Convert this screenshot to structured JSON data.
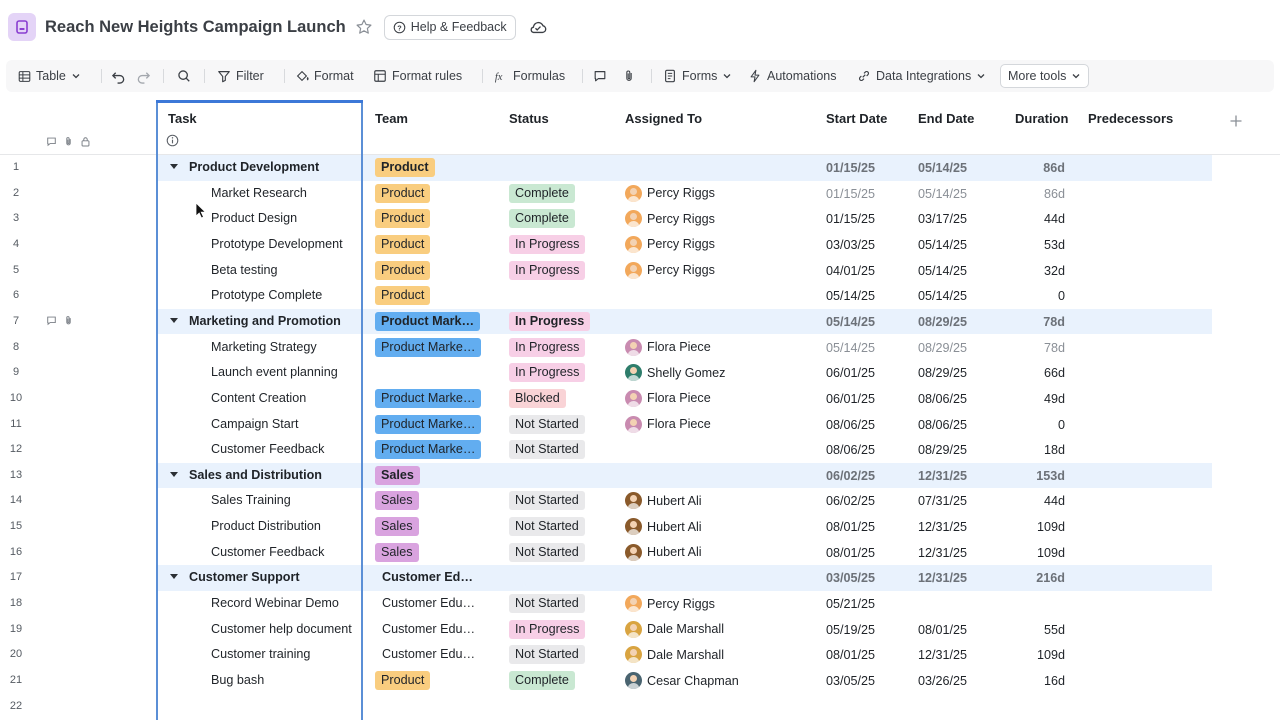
{
  "app": {
    "title": "Reach New Heights Campaign Launch",
    "help_label": "Help & Feedback"
  },
  "toolbar": {
    "view_label": "Table",
    "filter_label": "Filter",
    "format_label": "Format",
    "format_rules_label": "Format rules",
    "formulas_label": "Formulas",
    "forms_label": "Forms",
    "automations_label": "Automations",
    "data_integrations_label": "Data Integrations",
    "more_tools_label": "More tools"
  },
  "columns": {
    "task": "Task",
    "team": "Team",
    "status": "Status",
    "assigned": "Assigned To",
    "start": "Start Date",
    "end": "End Date",
    "duration": "Duration",
    "predecessors": "Predecessors"
  },
  "colors": {
    "product": "#f9cd7f",
    "marketing": "#62adf0",
    "sales": "#d9a3df",
    "complete": "#c9e8d2",
    "in_progress": "#f7cfe6",
    "blocked": "#f9d3d6",
    "not_started": "#e9e9eb",
    "selection_frame": "#3c78d8",
    "group_band": "#e9f2fd"
  },
  "rows": [
    {
      "num": "1",
      "type": "group",
      "task": "Product Development",
      "team": "Product",
      "team_color": "product",
      "status": "",
      "status_color": "",
      "assigned": "",
      "avatar": "",
      "start": "01/15/25",
      "end": "05/14/25",
      "duration": "86d"
    },
    {
      "num": "2",
      "type": "child",
      "task": "Market Research",
      "team": "Product",
      "team_color": "product",
      "status": "Complete",
      "status_color": "complete",
      "assigned": "Percy Riggs",
      "avatar": "#f2a85b",
      "start": "01/15/25",
      "end": "05/14/25",
      "duration": "86d",
      "muted": true
    },
    {
      "num": "3",
      "type": "child",
      "task": "Product Design",
      "team": "Product",
      "team_color": "product",
      "status": "Complete",
      "status_color": "complete",
      "assigned": "Percy Riggs",
      "avatar": "#f2a85b",
      "start": "01/15/25",
      "end": "03/17/25",
      "duration": "44d"
    },
    {
      "num": "4",
      "type": "child",
      "task": "Prototype Development",
      "team": "Product",
      "team_color": "product",
      "status": "In Progress",
      "status_color": "in_progress",
      "assigned": "Percy Riggs",
      "avatar": "#f2a85b",
      "start": "03/03/25",
      "end": "05/14/25",
      "duration": "53d"
    },
    {
      "num": "5",
      "type": "child",
      "task": "Beta testing",
      "team": "Product",
      "team_color": "product",
      "status": "In Progress",
      "status_color": "in_progress",
      "assigned": "Percy Riggs",
      "avatar": "#f2a85b",
      "start": "04/01/25",
      "end": "05/14/25",
      "duration": "32d"
    },
    {
      "num": "6",
      "type": "child",
      "task": "Prototype Complete",
      "team": "Product",
      "team_color": "product",
      "status": "",
      "status_color": "",
      "assigned": "",
      "avatar": "",
      "start": "05/14/25",
      "end": "05/14/25",
      "duration": "0"
    },
    {
      "num": "7",
      "type": "group",
      "task": "Marketing and Promotion",
      "team": "Product Mark…",
      "team_color": "marketing",
      "status": "In Progress",
      "status_color": "in_progress",
      "assigned": "",
      "avatar": "",
      "start": "05/14/25",
      "end": "08/29/25",
      "duration": "78d",
      "icons": true
    },
    {
      "num": "8",
      "type": "child",
      "task": "Marketing Strategy",
      "team": "Product Marke…",
      "team_color": "marketing",
      "status": "In Progress",
      "status_color": "in_progress",
      "assigned": "Flora Piece",
      "avatar": "#c98bb0",
      "start": "05/14/25",
      "end": "08/29/25",
      "duration": "78d",
      "muted": true
    },
    {
      "num": "9",
      "type": "child",
      "task": "Launch event planning",
      "team": "",
      "team_color": "",
      "status": "In Progress",
      "status_color": "in_progress",
      "assigned": "Shelly Gomez",
      "avatar": "#2e7d6b",
      "start": "06/01/25",
      "end": "08/29/25",
      "duration": "66d"
    },
    {
      "num": "10",
      "type": "child",
      "task": "Content Creation",
      "team": "Product Marke…",
      "team_color": "marketing",
      "status": "Blocked",
      "status_color": "blocked",
      "assigned": "Flora Piece",
      "avatar": "#c98bb0",
      "start": "06/01/25",
      "end": "08/06/25",
      "duration": "49d"
    },
    {
      "num": "11",
      "type": "child",
      "task": "Campaign Start",
      "team": "Product Marke…",
      "team_color": "marketing",
      "status": "Not Started",
      "status_color": "not_started",
      "assigned": "Flora Piece",
      "avatar": "#c98bb0",
      "start": "08/06/25",
      "end": "08/06/25",
      "duration": "0"
    },
    {
      "num": "12",
      "type": "child",
      "task": "Customer Feedback",
      "team": "Product Marke…",
      "team_color": "marketing",
      "status": "Not Started",
      "status_color": "not_started",
      "assigned": "",
      "avatar": "",
      "start": "08/06/25",
      "end": "08/29/25",
      "duration": "18d"
    },
    {
      "num": "13",
      "type": "group",
      "task": "Sales and Distribution",
      "team": "Sales",
      "team_color": "sales",
      "status": "",
      "status_color": "",
      "assigned": "",
      "avatar": "",
      "start": "06/02/25",
      "end": "12/31/25",
      "duration": "153d"
    },
    {
      "num": "14",
      "type": "child",
      "task": "Sales Training",
      "team": "Sales",
      "team_color": "sales",
      "status": "Not Started",
      "status_color": "not_started",
      "assigned": "Hubert Ali",
      "avatar": "#8a5a2b",
      "start": "06/02/25",
      "end": "07/31/25",
      "duration": "44d"
    },
    {
      "num": "15",
      "type": "child",
      "task": "Product Distribution",
      "team": "Sales",
      "team_color": "sales",
      "status": "Not Started",
      "status_color": "not_started",
      "assigned": "Hubert Ali",
      "avatar": "#8a5a2b",
      "start": "08/01/25",
      "end": "12/31/25",
      "duration": "109d"
    },
    {
      "num": "16",
      "type": "child",
      "task": "Customer Feedback",
      "team": "Sales",
      "team_color": "sales",
      "status": "Not Started",
      "status_color": "not_started",
      "assigned": "Hubert Ali",
      "avatar": "#8a5a2b",
      "start": "08/01/25",
      "end": "12/31/25",
      "duration": "109d"
    },
    {
      "num": "17",
      "type": "group",
      "task": "Customer Support",
      "team": "Customer Ed…",
      "team_color": "",
      "status": "",
      "status_color": "",
      "assigned": "",
      "avatar": "",
      "start": "03/05/25",
      "end": "12/31/25",
      "duration": "216d"
    },
    {
      "num": "18",
      "type": "child",
      "task": "Record Webinar Demo",
      "team": "Customer Edu…",
      "team_color": "",
      "status": "Not Started",
      "status_color": "not_started",
      "assigned": "Percy Riggs",
      "avatar": "#f2a85b",
      "start": "05/21/25",
      "end": "",
      "duration": ""
    },
    {
      "num": "19",
      "type": "child",
      "task": "Customer help document",
      "team": "Customer Edu…",
      "team_color": "",
      "status": "In Progress",
      "status_color": "in_progress",
      "assigned": "Dale Marshall",
      "avatar": "#d9a441",
      "start": "05/19/25",
      "end": "08/01/25",
      "duration": "55d"
    },
    {
      "num": "20",
      "type": "child",
      "task": "Customer training",
      "team": "Customer Edu…",
      "team_color": "",
      "status": "Not Started",
      "status_color": "not_started",
      "assigned": "Dale Marshall",
      "avatar": "#d9a441",
      "start": "08/01/25",
      "end": "12/31/25",
      "duration": "109d"
    },
    {
      "num": "21",
      "type": "child",
      "task": "Bug bash",
      "team": "Product",
      "team_color": "product",
      "status": "Complete",
      "status_color": "complete",
      "assigned": "Cesar Chapman",
      "avatar": "#4a6470",
      "start": "03/05/25",
      "end": "03/26/25",
      "duration": "16d"
    },
    {
      "num": "22",
      "type": "empty",
      "task": "",
      "team": "",
      "team_color": "",
      "status": "",
      "status_color": "",
      "assigned": "",
      "avatar": "",
      "start": "",
      "end": "",
      "duration": ""
    }
  ]
}
